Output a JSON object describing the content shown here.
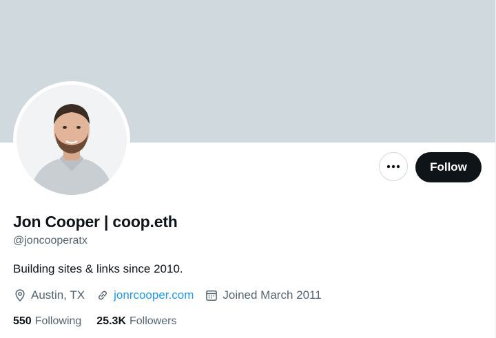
{
  "profile": {
    "display_name": "Jon Cooper | coop.eth",
    "handle": "@joncooperatx",
    "bio": "Building sites & links since 2010.",
    "location": "Austin, TX",
    "website": "jonrcooper.com",
    "joined": "Joined March 2011"
  },
  "actions": {
    "follow_label": "Follow"
  },
  "stats": {
    "following_count": "550",
    "following_label": "Following",
    "followers_count": "25.3K",
    "followers_label": "Followers"
  },
  "colors": {
    "banner": "#cfd9de",
    "accent_link": "#1d9bf0",
    "primary_text": "#0f1419",
    "secondary_text": "#536471",
    "follow_button": "#0f1419"
  },
  "icons": {
    "more": "more-horizontal-icon",
    "location": "location-pin-icon",
    "link": "link-icon",
    "calendar": "calendar-icon"
  }
}
